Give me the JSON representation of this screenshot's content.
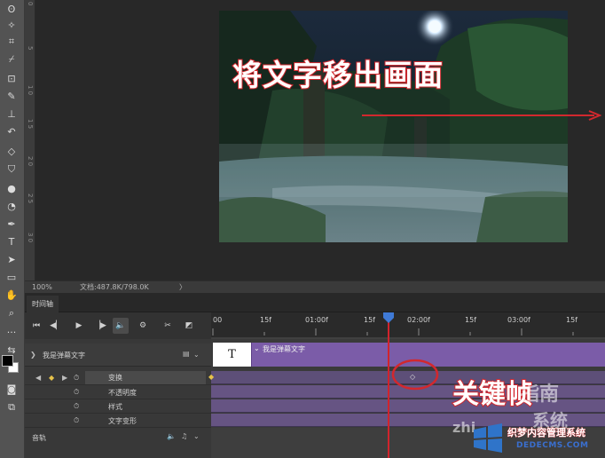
{
  "tools": [
    {
      "name": "lasso-tool-icon",
      "glyph": "ʘ"
    },
    {
      "name": "magic-wand-tool-icon",
      "glyph": "✧"
    },
    {
      "name": "crop-tool-icon",
      "glyph": "⌗"
    },
    {
      "name": "eyedropper-tool-icon",
      "glyph": "⌿"
    },
    {
      "name": "frame-tool-icon",
      "glyph": "⊡"
    },
    {
      "name": "brush-tool-icon",
      "glyph": "✎"
    },
    {
      "name": "clone-stamp-tool-icon",
      "glyph": "⊥"
    },
    {
      "name": "history-brush-tool-icon",
      "glyph": "↶"
    },
    {
      "name": "eraser-tool-icon",
      "glyph": "◇"
    },
    {
      "name": "paint-bucket-tool-icon",
      "glyph": "⛉"
    },
    {
      "name": "blur-tool-icon",
      "glyph": "●"
    },
    {
      "name": "dodge-tool-icon",
      "glyph": "◔"
    },
    {
      "name": "pen-tool-icon",
      "glyph": "✒"
    },
    {
      "name": "type-tool-icon",
      "glyph": "T"
    },
    {
      "name": "path-selection-tool-icon",
      "glyph": "➤"
    },
    {
      "name": "shape-tool-icon",
      "glyph": "▭"
    },
    {
      "name": "hand-tool-icon",
      "glyph": "✋"
    },
    {
      "name": "zoom-tool-icon",
      "glyph": "⌕"
    },
    {
      "name": "more-tools-icon",
      "glyph": "···"
    }
  ],
  "ruler": {
    "labels": [
      "0",
      "5",
      "1 0",
      "1 5",
      "2 0",
      "2 5",
      "3 0"
    ]
  },
  "canvas": {
    "overlay_text": "将文字移出画面"
  },
  "status": {
    "zoom": "100%",
    "doc": "文档:487.8K/798.0K",
    "more": "〉"
  },
  "panel": {
    "tab_label": "时间轴"
  },
  "time_ruler": {
    "labels": [
      "00",
      "15f",
      "01:00f",
      "15f",
      "02:00f",
      "15f",
      "03:00f",
      "15f"
    ]
  },
  "layer": {
    "name": "我是弹幕文字",
    "clip_name": "我是弹幕文字",
    "clip_thumb": "T",
    "properties": [
      "变换",
      "不透明度",
      "样式",
      "文字变形"
    ],
    "audio_label": "音轨"
  },
  "annotations": {
    "keyframe_label": "关键帧"
  },
  "watermark": {
    "line1": "指南",
    "line2": "zhi",
    "line3": "系统",
    "badge": "织梦内容管理系统",
    "domain": "DEDECMS.COM"
  },
  "colors": {
    "clip": "#7b5ca8",
    "annotation_red": "#d2282e",
    "playhead": "#d1232c",
    "keyframe": "#e6c24a"
  }
}
